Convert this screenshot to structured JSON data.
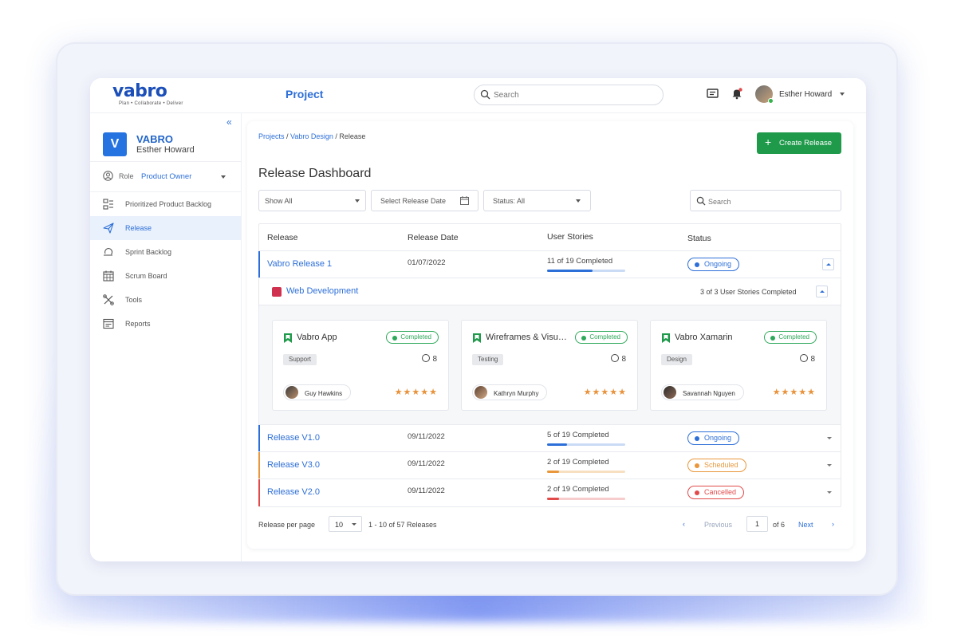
{
  "app": {
    "logo_text": "vabro",
    "logo_tagline": "Plan • Collaborate • Deliver",
    "page_title": "Project",
    "search_placeholder": "Search",
    "user_name": "Esther Howard"
  },
  "sidebar": {
    "org_initial": "V",
    "org_name": "VABRO",
    "org_user": "Esther Howard",
    "role_label": "Role",
    "role_value": "Product Owner",
    "items": [
      {
        "label": "Prioritized Product Backlog",
        "icon": "backlog-icon"
      },
      {
        "label": "Release",
        "icon": "send-icon",
        "active": true
      },
      {
        "label": "Sprint Backlog",
        "icon": "sprint-icon"
      },
      {
        "label": "Scrum Board",
        "icon": "calendar-icon"
      },
      {
        "label": "Tools",
        "icon": "tools-icon"
      },
      {
        "label": "Reports",
        "icon": "reports-icon"
      }
    ]
  },
  "main": {
    "breadcrumb": {
      "projects": "Projects",
      "sep1": " / ",
      "project": "Vabro Design",
      "sep2": " / ",
      "current": "Release"
    },
    "create_button": "Create Release",
    "title": "Release Dashboard",
    "filters": {
      "show": "Show All",
      "date": "Select Release Date",
      "status": "Status: All",
      "search_placeholder": "Search"
    },
    "columns": {
      "release": "Release",
      "date": "Release Date",
      "stories": "User Stories",
      "status": "Status"
    },
    "releases": [
      {
        "name": "Vabro Release 1",
        "date": "01/07/2022",
        "stories": "11 of 19 Completed",
        "progress": 0.58,
        "status": "Ongoing",
        "color": "#2d6fd8",
        "track": "#c9dbf5"
      },
      {
        "name": "Release V1.0",
        "date": "09/11/2022",
        "stories": "5 of 19 Completed",
        "progress": 0.26,
        "status": "Ongoing",
        "color": "#2d6fd8",
        "track": "#c9dbf5"
      },
      {
        "name": "Release V3.0",
        "date": "09/11/2022",
        "stories": "2 of 19 Completed",
        "progress": 0.15,
        "status": "Scheduled",
        "color": "#e9973a",
        "track": "#f7dfc2"
      },
      {
        "name": "Release V2.0",
        "date": "09/11/2022",
        "stories": "2 of 19 Completed",
        "progress": 0.15,
        "status": "Cancelled",
        "color": "#e24a4a",
        "track": "#f6cccc"
      }
    ],
    "epic": {
      "name": "Web Development",
      "count": "3 of 3 User Stories Completed"
    },
    "cards": [
      {
        "title": "Vabro App",
        "badge": "Completed",
        "tag": "Support",
        "points": "8",
        "person": "Guy Hawkins",
        "stars": "★★★★★",
        "rating": 5
      },
      {
        "title": "Wireframes & Visual Design",
        "badge": "Completed",
        "tag": "Testing",
        "points": "8",
        "person": "Kathryn Murphy",
        "stars": "★★★★★",
        "rating": 5
      },
      {
        "title": "Vabro Xamarin",
        "badge": "Completed",
        "tag": "Design",
        "points": "8",
        "person": "Savannah Nguyen",
        "stars": "★★★★★",
        "rating": 5
      }
    ],
    "pagination": {
      "per_page_label": "Release per page",
      "per_page": "10",
      "range": "1 - 10 of 57 Releases",
      "prev": "Previous",
      "page": "1",
      "of": "of 6",
      "next": "Next"
    }
  }
}
